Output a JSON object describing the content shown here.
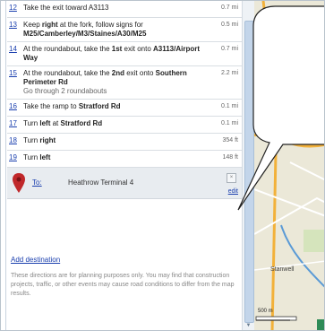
{
  "steps": [
    {
      "num": "12",
      "text_html": "Take the exit toward A3113",
      "dist": "0.7 mi"
    },
    {
      "num": "13",
      "text_html": "Keep <b>right</b> at the fork, follow signs for <b>M25/Camberley/M3/Staines/A30/M25</b>",
      "dist": "0.5 mi"
    },
    {
      "num": "14",
      "text_html": "At the roundabout, take the <b>1st</b> exit onto <b>A3113/Airport Way</b>",
      "dist": "0.7 mi"
    },
    {
      "num": "15",
      "text_html": "At the roundabout, take the <b>2nd</b> exit onto <b>Southern Perimeter Rd</b><br><span class=\"note\">Go through 2 roundabouts</span>",
      "dist": "2.2 mi"
    },
    {
      "num": "16",
      "text_html": "Take the ramp to <b>Stratford Rd</b>",
      "dist": "0.1 mi"
    },
    {
      "num": "17",
      "text_html": "Turn <b>left</b> at <b>Stratford Rd</b>",
      "dist": "0.1 mi"
    },
    {
      "num": "18",
      "text_html": "Turn <b>right</b>",
      "dist": "354 ft"
    },
    {
      "num": "19",
      "text_html": "Turn <b>left</b>",
      "dist": "148 ft"
    }
  ],
  "destination": {
    "to_label": "To:",
    "place": "Heathrow Terminal 4",
    "close_glyph": "×",
    "edit_label": "edit"
  },
  "add_destination": "Add destination",
  "disclaimer": "These directions are for planning purposes only. You may find that construction projects, traffic, or other events may cause road conditions to differ from the map results.",
  "map": {
    "town_label": "Stanwell",
    "scale_label": "500 m",
    "zoom_glyph": "−"
  },
  "scroll": {
    "down_glyph": "▼"
  },
  "colors": {
    "link": "#1a3fae",
    "pin": "#c0282b",
    "road_major": "#f2b13a",
    "road_minor": "#ffffff",
    "water": "#a8c4e0",
    "park": "#cfe2b5"
  }
}
